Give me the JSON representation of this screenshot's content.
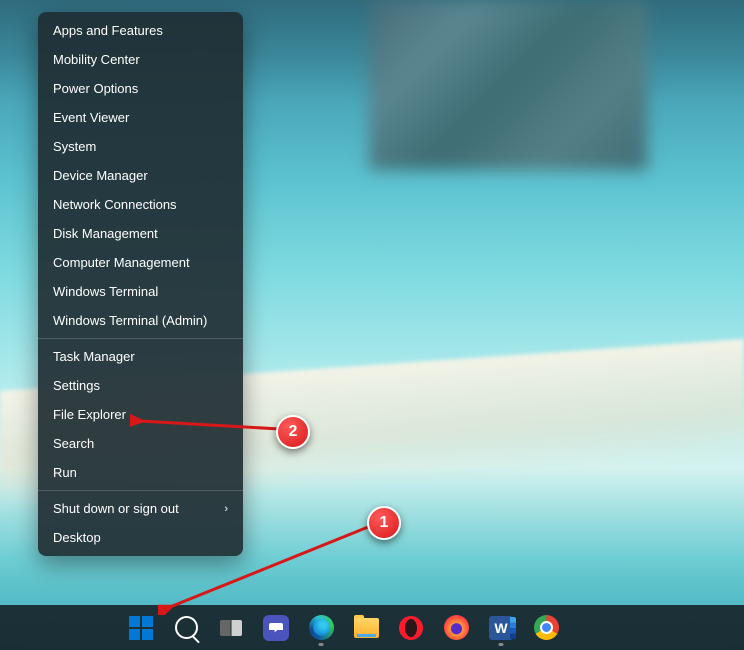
{
  "menu": {
    "group1": [
      {
        "label": "Apps and Features",
        "name": "apps-and-features"
      },
      {
        "label": "Mobility Center",
        "name": "mobility-center"
      },
      {
        "label": "Power Options",
        "name": "power-options"
      },
      {
        "label": "Event Viewer",
        "name": "event-viewer"
      },
      {
        "label": "System",
        "name": "system"
      },
      {
        "label": "Device Manager",
        "name": "device-manager"
      },
      {
        "label": "Network Connections",
        "name": "network-connections"
      },
      {
        "label": "Disk Management",
        "name": "disk-management"
      },
      {
        "label": "Computer Management",
        "name": "computer-management"
      },
      {
        "label": "Windows Terminal",
        "name": "windows-terminal"
      },
      {
        "label": "Windows Terminal (Admin)",
        "name": "windows-terminal-admin"
      }
    ],
    "group2": [
      {
        "label": "Task Manager",
        "name": "task-manager"
      },
      {
        "label": "Settings",
        "name": "settings"
      },
      {
        "label": "File Explorer",
        "name": "file-explorer"
      },
      {
        "label": "Search",
        "name": "search"
      },
      {
        "label": "Run",
        "name": "run"
      }
    ],
    "group3": [
      {
        "label": "Shut down or sign out",
        "name": "shutdown-signout",
        "submenu": true
      },
      {
        "label": "Desktop",
        "name": "desktop"
      }
    ]
  },
  "taskbar": {
    "items": [
      {
        "name": "start-button",
        "type": "start"
      },
      {
        "name": "search-button",
        "type": "search"
      },
      {
        "name": "task-view-button",
        "type": "taskview"
      },
      {
        "name": "chat-button",
        "type": "chat"
      },
      {
        "name": "edge-button",
        "type": "edge",
        "running": true
      },
      {
        "name": "file-explorer-button",
        "type": "folder"
      },
      {
        "name": "opera-button",
        "type": "opera"
      },
      {
        "name": "firefox-button",
        "type": "firefox"
      },
      {
        "name": "word-button",
        "type": "word",
        "letter": "W",
        "running": true
      },
      {
        "name": "chrome-canary-button",
        "type": "chrome"
      }
    ]
  },
  "annotations": {
    "b1": "1",
    "b2": "2"
  }
}
